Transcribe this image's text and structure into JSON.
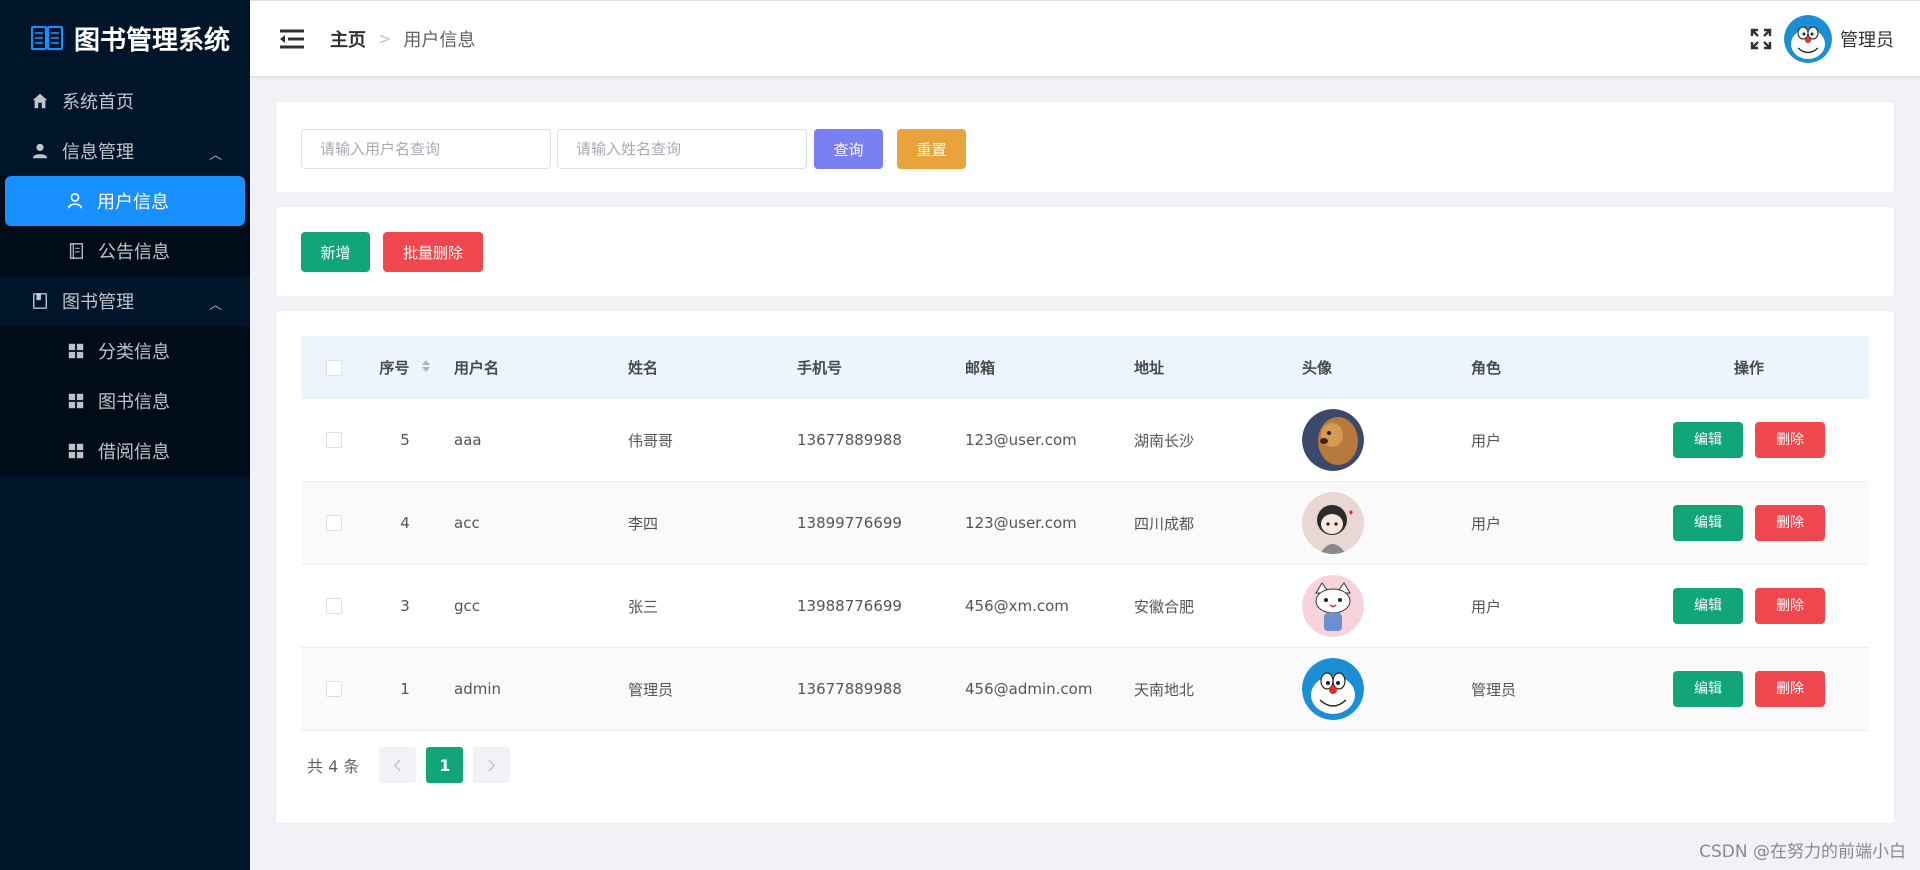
{
  "app": {
    "title": "图书管理系统"
  },
  "sidebar": {
    "items": [
      {
        "label": "系统首页",
        "icon": "home-icon"
      },
      {
        "label": "信息管理",
        "icon": "user-icon",
        "children": [
          {
            "label": "用户信息",
            "icon": "user-outline-icon",
            "active": true
          },
          {
            "label": "公告信息",
            "icon": "notebook-icon"
          }
        ]
      },
      {
        "label": "图书管理",
        "icon": "book-icon",
        "children": [
          {
            "label": "分类信息",
            "icon": "grid-icon"
          },
          {
            "label": "图书信息",
            "icon": "grid-icon"
          },
          {
            "label": "借阅信息",
            "icon": "grid-icon"
          }
        ]
      }
    ]
  },
  "header": {
    "breadcrumb": {
      "home": "主页",
      "current": "用户信息"
    },
    "user": "管理员"
  },
  "search": {
    "username_placeholder": "请输入用户名查询",
    "name_placeholder": "请输入姓名查询",
    "query_label": "查询",
    "reset_label": "重置"
  },
  "operations": {
    "add_label": "新增",
    "batch_delete_label": "批量删除"
  },
  "table": {
    "columns": [
      "序号",
      "用户名",
      "姓名",
      "手机号",
      "邮箱",
      "地址",
      "头像",
      "角色",
      "操作"
    ],
    "rows": [
      {
        "id": "5",
        "username": "aaa",
        "name": "伟哥哥",
        "phone": "13677889988",
        "email": "123@user.com",
        "address": "湖南长沙",
        "avatar": "dog",
        "role": "用户"
      },
      {
        "id": "4",
        "username": "acc",
        "name": "李四",
        "phone": "13899776699",
        "email": "123@user.com",
        "address": "四川成都",
        "avatar": "girl",
        "role": "用户"
      },
      {
        "id": "3",
        "username": "gcc",
        "name": "张三",
        "phone": "13988776699",
        "email": "456@xm.com",
        "address": "安徽合肥",
        "avatar": "cat",
        "role": "用户"
      },
      {
        "id": "1",
        "username": "admin",
        "name": "管理员",
        "phone": "13677889988",
        "email": "456@admin.com",
        "address": "天南地北",
        "avatar": "doraemon",
        "role": "管理员"
      }
    ],
    "edit_label": "编辑",
    "delete_label": "删除"
  },
  "pagination": {
    "total_text": "共 4 条",
    "current_page": "1"
  },
  "watermark": "CSDN @在努力的前端小白",
  "colors": {
    "sidebar": "#001529",
    "active": "#1890ff",
    "primary": "#13a57a",
    "danger": "#f0474e",
    "query": "#7a80f2",
    "reset": "#e8a33d"
  }
}
